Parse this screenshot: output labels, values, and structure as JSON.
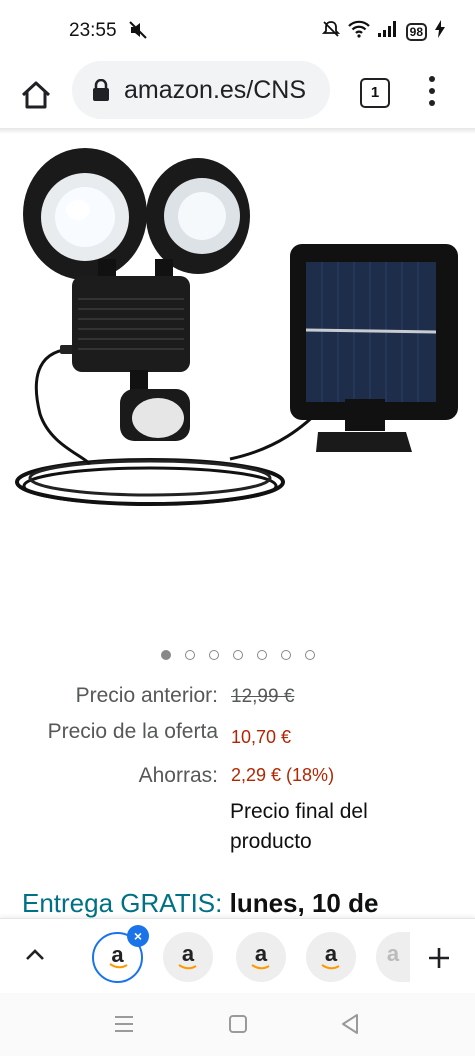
{
  "status_bar": {
    "time": "23:55",
    "battery": "98",
    "icons": [
      "mute-icon",
      "dnd-icon",
      "wifi-icon",
      "signal-icon",
      "battery-icon",
      "charging-icon"
    ]
  },
  "browser": {
    "url": "amazon.es/CNS",
    "tab_count": "1",
    "icons": [
      "home-icon",
      "lock-icon",
      "tabs-icon",
      "menu-icon"
    ]
  },
  "product": {
    "image_description": "solar-security-light",
    "carousel": {
      "total": 7,
      "active_index": 0
    }
  },
  "pricing": {
    "previous_label": "Precio anterior:",
    "previous_value": "12,99 €",
    "deal_label": "Precio de la oferta",
    "deal_value": "10,70 €",
    "savings_label": "Ahorras:",
    "savings_value": "2,29 € (18%)",
    "final_note_line1": "Precio final del",
    "final_note_line2": "producto"
  },
  "delivery": {
    "label": "Entrega GRATIS:",
    "date": "lunes, 10 de"
  },
  "tab_strip": {
    "tabs": [
      {
        "letter": "a",
        "current": true
      },
      {
        "letter": "a",
        "current": false
      },
      {
        "letter": "a",
        "current": false
      },
      {
        "letter": "a",
        "current": false
      },
      {
        "letter": "a",
        "current": false
      }
    ],
    "close_symbol": "×"
  },
  "colors": {
    "deal_red": "#b12704",
    "link_teal": "#007185",
    "chrome_blue": "#1a73e8",
    "amazon_orange": "#ff9900"
  }
}
